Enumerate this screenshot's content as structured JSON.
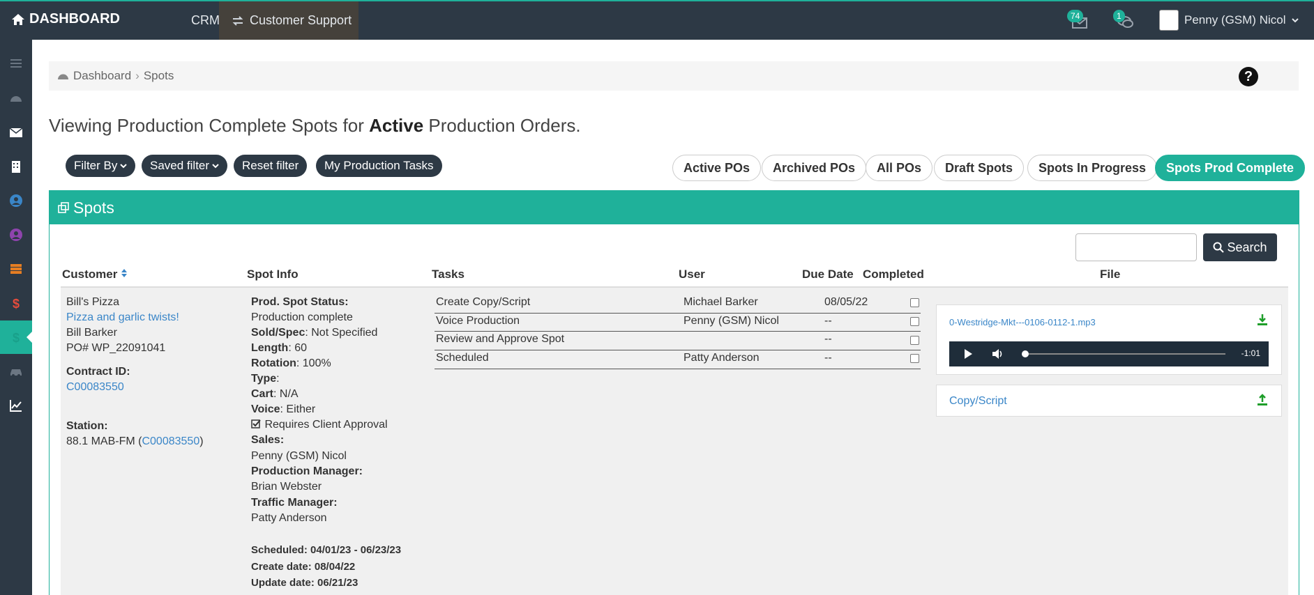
{
  "header": {
    "brand": "DASHBOARD",
    "crm": "CRM",
    "customer_support": "Customer Support",
    "mail_count": "74",
    "chat_count": "1",
    "user_name": "Penny (GSM) Nicol"
  },
  "breadcrumb": {
    "home": "Dashboard",
    "sep": "›",
    "current": "Spots"
  },
  "title": {
    "prefix": "Viewing Production Complete Spots for ",
    "bold": "Active",
    "suffix": " Production Orders."
  },
  "filters": {
    "filter_by": "Filter By",
    "saved_filter": "Saved filter",
    "reset": "Reset filter",
    "my_tasks": "My Production Tasks"
  },
  "tabs": [
    "Active POs",
    "Archived POs",
    "All POs",
    "Draft Spots",
    "Spots In Progress",
    "Spots Prod Complete"
  ],
  "panel": {
    "title": "Spots",
    "search_button": "Search"
  },
  "columns": {
    "customer": "Customer",
    "spot_info": "Spot Info",
    "tasks": "Tasks",
    "user": "User",
    "due": "Due Date",
    "completed": "Completed",
    "file": "File"
  },
  "customer": {
    "name": "Bill's Pizza",
    "slogan": "Pizza and garlic twists!",
    "contact": "Bill Barker",
    "po": "PO# WP_22091041",
    "contract_label": "Contract ID:",
    "contract_id": "C00083550",
    "station_label": "Station:",
    "station": "88.1 MAB-FM (",
    "station_link": "C00083550",
    "station_close": ")"
  },
  "spot": {
    "status_label": "Prod. Spot Status:",
    "status": "Production complete",
    "sold_label": "Sold/Spec",
    "sold": ": Not Specified",
    "length_label": "Length",
    "length": ": 60",
    "rotation_label": "Rotation",
    "rotation": ": 100%",
    "type_label": "Type",
    "type": ":",
    "cart_label": "Cart",
    "cart": ": N/A",
    "voice_label": "Voice",
    "voice": ": Either",
    "approval": "Requires Client Approval",
    "sales_label": "Sales:",
    "sales": "Penny (GSM) Nicol",
    "pm_label": "Production Manager:",
    "pm": "Brian Webster",
    "tm_label": "Traffic Manager:",
    "tm": "Patty Anderson",
    "scheduled": "Scheduled: 04/01/23 - 06/23/23",
    "created": "Create date: 08/04/22",
    "updated": "Update date: 06/21/23"
  },
  "tasks": [
    {
      "name": "Create Copy/Script",
      "user": "Michael Barker",
      "due": "08/05/22"
    },
    {
      "name": "Voice Production",
      "user": "Penny (GSM) Nicol",
      "due": "--"
    },
    {
      "name": "Review and Approve Spot",
      "user": "",
      "due": "--"
    },
    {
      "name": "Scheduled",
      "user": "Patty Anderson",
      "due": "--"
    }
  ],
  "file": {
    "audio_name": "0-Westridge-Mkt---0106-0112-1.mp3",
    "time": "-1:01",
    "copy_script": "Copy/Script"
  }
}
